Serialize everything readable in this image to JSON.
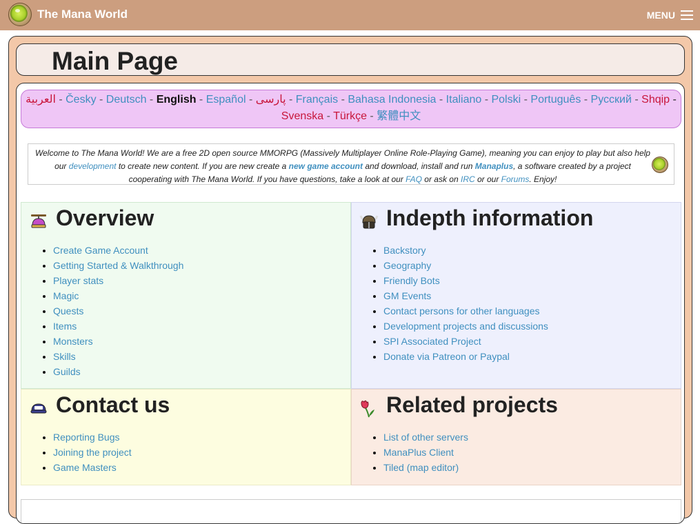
{
  "site": {
    "title": "The Mana World",
    "menu_label": "MENU"
  },
  "page": {
    "title": "Main Page"
  },
  "languages": {
    "current": "English",
    "items": [
      {
        "label": "العربية",
        "color": "red"
      },
      {
        "label": "Česky",
        "color": "blue"
      },
      {
        "label": "Deutsch",
        "color": "blue"
      },
      {
        "label": "English",
        "color": "current"
      },
      {
        "label": "Español",
        "color": "blue"
      },
      {
        "label": "پارسی",
        "color": "red"
      },
      {
        "label": "Français",
        "color": "blue"
      },
      {
        "label": "Bahasa Indonesia",
        "color": "blue"
      },
      {
        "label": "Italiano",
        "color": "blue"
      },
      {
        "label": "Polski",
        "color": "blue"
      },
      {
        "label": "Português",
        "color": "blue"
      },
      {
        "label": "Русский",
        "color": "blue"
      },
      {
        "label": "Shqip",
        "color": "red"
      },
      {
        "label": "Svenska",
        "color": "red"
      },
      {
        "label": "Türkçe",
        "color": "red"
      },
      {
        "label": "繁體中文",
        "color": "blue"
      }
    ],
    "separator": " - "
  },
  "welcome": {
    "p1": "Welcome to The Mana World! We are a free 2D open source MMORPG (Massively Multiplayer Online Role-Playing Game), meaning you can enjoy to play but also help our ",
    "link_development": "development",
    "p2": " to create new content. If you are new create a ",
    "link_new_account": "new game account",
    "p3": " and download, install and run ",
    "link_manaplus": "Manaplus",
    "p4": ", a software created by a project cooperating with The Mana World. If you have questions, take a look at our ",
    "link_faq": "FAQ",
    "p5": " or ask on ",
    "link_irc": "IRC",
    "p6": " or our ",
    "link_forums": "Forums",
    "p7": ". Enjoy!"
  },
  "sections": {
    "overview": {
      "title": "Overview",
      "icon": "propeller-hat-icon",
      "links": [
        "Create Game Account",
        "Getting Started & Walkthrough",
        "Player stats",
        "Magic",
        "Quests",
        "Items",
        "Monsters",
        "Skills",
        "Guilds"
      ]
    },
    "indepth": {
      "title": "Indepth information",
      "icon": "viking-helmet-icon",
      "links": [
        "Backstory",
        "Geography",
        "Friendly Bots",
        "GM Events",
        "Contact persons for other languages",
        "Development projects and discussions",
        "SPI Associated Project",
        "Donate via Patreon or Paypal"
      ]
    },
    "contact": {
      "title": "Contact us",
      "icon": "dev-cap-icon",
      "links": [
        "Reporting Bugs",
        "Joining the project",
        "Game Masters"
      ]
    },
    "related": {
      "title": "Related projects",
      "icon": "tulip-icon",
      "links": [
        "List of other servers",
        "ManaPlus Client",
        "Tiled (map editor)"
      ]
    }
  },
  "colors": {
    "topbar": "#cc9e7f",
    "frame": "#f3c8a9",
    "link": "#3f8fbf",
    "link_red": "#c8163b",
    "lang_box": "#efc6f6"
  }
}
